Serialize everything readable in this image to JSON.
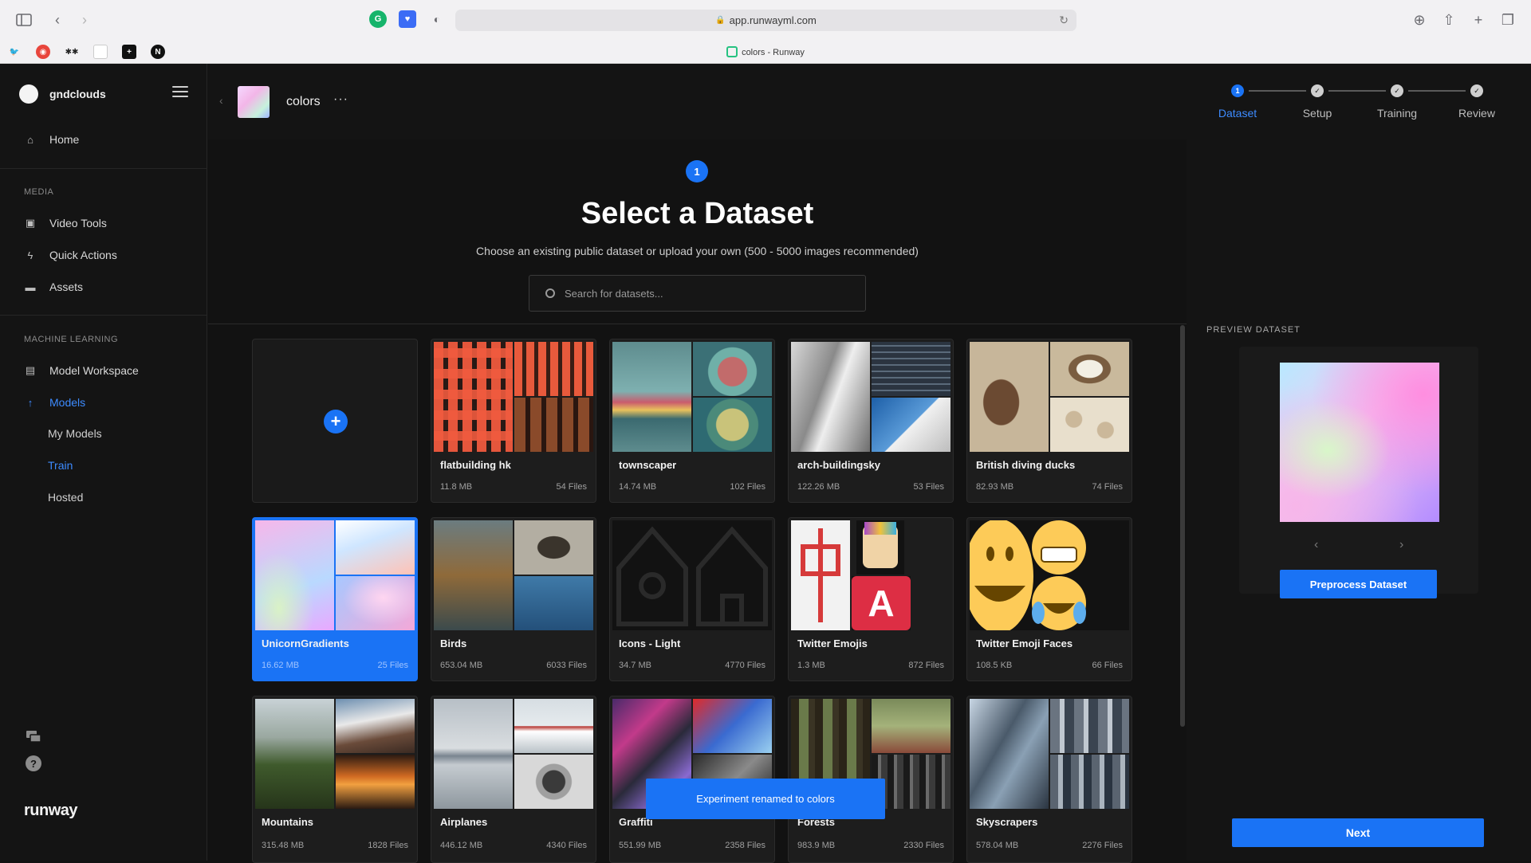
{
  "browser": {
    "url": "app.runwayml.com",
    "tab_title": "colors - Runway"
  },
  "sidebar": {
    "user": "gndclouds",
    "home": "Home",
    "media_label": "MEDIA",
    "media_items": [
      "Video Tools",
      "Quick Actions",
      "Assets"
    ],
    "ml_label": "MACHINE LEARNING",
    "ml_items": [
      "Model Workspace",
      "Models"
    ],
    "models_sub": [
      "My Models",
      "Train",
      "Hosted"
    ],
    "logo": "runway"
  },
  "header": {
    "project_name": "colors",
    "more": "···"
  },
  "stepper": {
    "steps": [
      "Dataset",
      "Setup",
      "Training",
      "Review"
    ],
    "active_number": "1"
  },
  "main": {
    "step_number": "1",
    "title": "Select a Dataset",
    "subtitle": "Choose an existing public dataset or upload your own (500 - 5000 images recommended)",
    "search_placeholder": "Search for datasets..."
  },
  "datasets": [
    {
      "name": "flatbuilding hk",
      "size": "11.8 MB",
      "files": "54 Files"
    },
    {
      "name": "townscaper",
      "size": "14.74 MB",
      "files": "102 Files"
    },
    {
      "name": "arch-buildingsky",
      "size": "122.26 MB",
      "files": "53 Files"
    },
    {
      "name": "British diving ducks",
      "size": "82.93 MB",
      "files": "74 Files"
    },
    {
      "name": "UnicornGradients",
      "size": "16.62 MB",
      "files": "25 Files"
    },
    {
      "name": "Birds",
      "size": "653.04 MB",
      "files": "6033 Files"
    },
    {
      "name": "Icons - Light",
      "size": "34.7 MB",
      "files": "4770 Files"
    },
    {
      "name": "Twitter Emojis",
      "size": "1.3 MB",
      "files": "872 Files"
    },
    {
      "name": "Twitter Emoji Faces",
      "size": "108.5 KB",
      "files": "66 Files"
    },
    {
      "name": "Mountains",
      "size": "315.48 MB",
      "files": "1828 Files"
    },
    {
      "name": "Airplanes",
      "size": "446.12 MB",
      "files": "4340 Files"
    },
    {
      "name": "Graffiti",
      "size": "551.99 MB",
      "files": "2358 Files"
    },
    {
      "name": "Forests",
      "size": "983.9 MB",
      "files": "2330 Files"
    },
    {
      "name": "Skyscrapers",
      "size": "578.04 MB",
      "files": "2276 Files"
    }
  ],
  "preview": {
    "label": "PREVIEW DATASET",
    "preprocess": "Preprocess Dataset",
    "next": "Next"
  },
  "toast": "Experiment renamed to colors",
  "colors": {
    "accent": "#1a73f5",
    "background": "#121212"
  }
}
